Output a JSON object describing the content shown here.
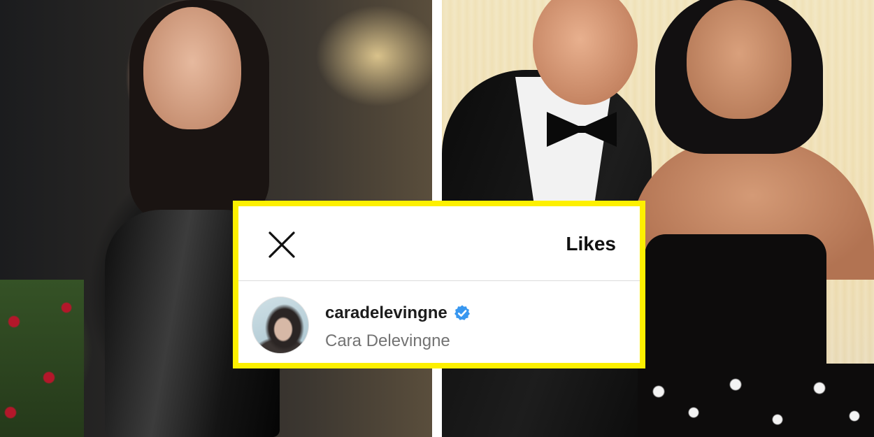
{
  "likes_panel": {
    "title": "Likes",
    "close_icon": "close-icon",
    "border_color": "#fdf000",
    "users": [
      {
        "username": "caradelevingne",
        "full_name": "Cara Delevingne",
        "verified": true,
        "verified_color": "#3897f0"
      }
    ]
  }
}
